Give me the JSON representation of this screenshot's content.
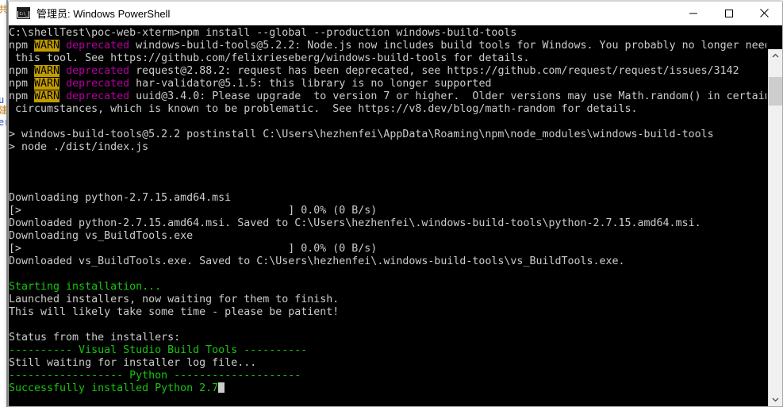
{
  "window": {
    "title": "管理员: Windows PowerShell",
    "icon": "console-icon",
    "controls": {
      "minimize_label": "Minimize",
      "maximize_label": "Maximize",
      "close_label": "Close"
    }
  },
  "scrollbar": {
    "up_label": "Scroll up",
    "down_label": "Scroll down"
  },
  "backdrop": {
    "fragments": [
      "共(",
      "u",
      "建",
      "er"
    ]
  },
  "terminal": {
    "colors": {
      "background": "#000000",
      "foreground": "#cccccc",
      "green": "#16c60c",
      "magenta": "#b4009e",
      "warn_badge_bg": "#c19c00",
      "warn_badge_fg": "#000000"
    },
    "lines": [
      {
        "segments": [
          {
            "t": "C:\\shellTest\\poc-web-xterm>npm install --global --production windows-build-tools",
            "c": "gray"
          }
        ]
      },
      {
        "segments": [
          {
            "t": "npm ",
            "c": "gray"
          },
          {
            "t": "WARN",
            "c": "warnbadge"
          },
          {
            "t": " ",
            "c": "gray"
          },
          {
            "t": "deprecated",
            "c": "magenta"
          },
          {
            "t": " windows-build-tools@5.2.2: Node.js now includes build tools for Windows. You probably no longer need",
            "c": "gray"
          }
        ]
      },
      {
        "segments": [
          {
            "t": " this tool. See https://github.com/felixrieseberg/windows-build-tools for details.",
            "c": "gray"
          }
        ]
      },
      {
        "segments": [
          {
            "t": "npm ",
            "c": "gray"
          },
          {
            "t": "WARN",
            "c": "warnbadge"
          },
          {
            "t": " ",
            "c": "gray"
          },
          {
            "t": "deprecated",
            "c": "magenta"
          },
          {
            "t": " request@2.88.2: request has been deprecated, see https://github.com/request/request/issues/3142",
            "c": "gray"
          }
        ]
      },
      {
        "segments": [
          {
            "t": "npm ",
            "c": "gray"
          },
          {
            "t": "WARN",
            "c": "warnbadge"
          },
          {
            "t": " ",
            "c": "gray"
          },
          {
            "t": "deprecated",
            "c": "magenta"
          },
          {
            "t": " har-validator@5.1.5: this library is no longer supported",
            "c": "gray"
          }
        ]
      },
      {
        "segments": [
          {
            "t": "npm ",
            "c": "gray"
          },
          {
            "t": "WARN",
            "c": "warnbadge"
          },
          {
            "t": " ",
            "c": "gray"
          },
          {
            "t": "deprecated",
            "c": "magenta"
          },
          {
            "t": " uuid@3.4.0: Please upgrade  to version 7 or higher.  Older versions may use Math.random() in certain",
            "c": "gray"
          }
        ]
      },
      {
        "segments": [
          {
            "t": " circumstances, which is known to be problematic.  See https://v8.dev/blog/math-random for details.",
            "c": "gray"
          }
        ]
      },
      {
        "segments": [
          {
            "t": "",
            "c": "gray"
          }
        ]
      },
      {
        "segments": [
          {
            "t": "> windows-build-tools@5.2.2 postinstall C:\\Users\\hezhenfei\\AppData\\Roaming\\npm\\node_modules\\windows-build-tools",
            "c": "gray"
          }
        ]
      },
      {
        "segments": [
          {
            "t": "> node ./dist/index.js",
            "c": "gray"
          }
        ]
      },
      {
        "segments": [
          {
            "t": "",
            "c": "gray"
          }
        ]
      },
      {
        "segments": [
          {
            "t": "",
            "c": "gray"
          }
        ]
      },
      {
        "segments": [
          {
            "t": "",
            "c": "gray"
          }
        ]
      },
      {
        "segments": [
          {
            "t": "Downloading python-2.7.15.amd64.msi",
            "c": "gray"
          }
        ]
      },
      {
        "segments": [
          {
            "t": "[>                                          ] 0.0% (0 B/s)",
            "c": "gray"
          }
        ]
      },
      {
        "segments": [
          {
            "t": "Downloaded python-2.7.15.amd64.msi. Saved to C:\\Users\\hezhenfei\\.windows-build-tools\\python-2.7.15.amd64.msi.",
            "c": "gray"
          }
        ]
      },
      {
        "segments": [
          {
            "t": "Downloading vs_BuildTools.exe",
            "c": "gray"
          }
        ]
      },
      {
        "segments": [
          {
            "t": "[>                                          ] 0.0% (0 B/s)",
            "c": "gray"
          }
        ]
      },
      {
        "segments": [
          {
            "t": "Downloaded vs_BuildTools.exe. Saved to C:\\Users\\hezhenfei\\.windows-build-tools\\vs_BuildTools.exe.",
            "c": "gray"
          }
        ]
      },
      {
        "segments": [
          {
            "t": "",
            "c": "gray"
          }
        ]
      },
      {
        "segments": [
          {
            "t": "Starting installation...",
            "c": "green"
          }
        ]
      },
      {
        "segments": [
          {
            "t": "Launched installers, now waiting for them to finish.",
            "c": "gray"
          }
        ]
      },
      {
        "segments": [
          {
            "t": "This will likely take some time - please be patient!",
            "c": "gray"
          }
        ]
      },
      {
        "segments": [
          {
            "t": "",
            "c": "gray"
          }
        ]
      },
      {
        "segments": [
          {
            "t": "Status from the installers:",
            "c": "gray"
          }
        ]
      },
      {
        "segments": [
          {
            "t": "---------- Visual Studio Build Tools ----------",
            "c": "green"
          }
        ]
      },
      {
        "segments": [
          {
            "t": "Still waiting for installer log file...",
            "c": "gray"
          }
        ]
      },
      {
        "segments": [
          {
            "t": "------------------ Python --------------------",
            "c": "green"
          }
        ]
      },
      {
        "segments": [
          {
            "t": "Successfully installed Python 2.7",
            "c": "green"
          },
          {
            "t": "CURSOR",
            "c": "cursor"
          }
        ]
      }
    ]
  }
}
